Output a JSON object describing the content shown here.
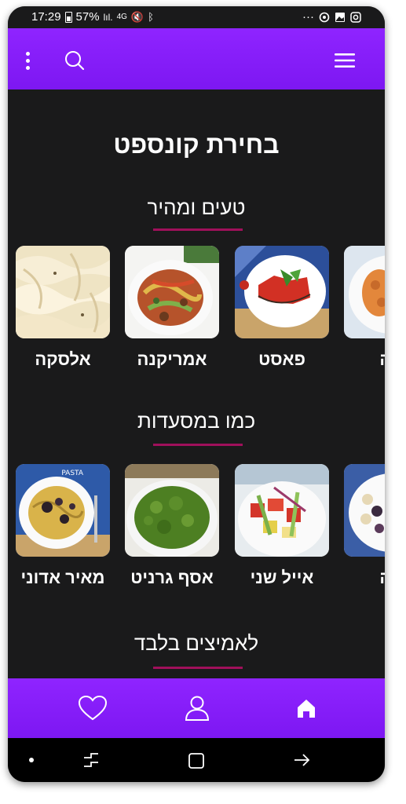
{
  "status_bar": {
    "time": "17:29",
    "battery": "57%",
    "signal": "4G",
    "more": "···"
  },
  "header": {
    "icons": [
      "menu-dots-icon",
      "search-icon",
      "hamburger-icon"
    ],
    "accent_color": "#8a21fb"
  },
  "page_title": "בחירת קונספט",
  "sections": [
    {
      "title": "טעים ומהיר",
      "cards": [
        "אלסקה",
        "אמריקנה",
        "פאסט",
        "פה"
      ]
    },
    {
      "title": "כמו במסעדות",
      "cards": [
        "מאיר אדוני",
        "אסף גרניט",
        "אייל שני",
        "פה"
      ]
    },
    {
      "title": "לאמיצים בלבד",
      "cards": []
    }
  ],
  "bottom_nav": {
    "items": [
      "heart-icon",
      "user-icon",
      "home-icon"
    ]
  },
  "system_nav": {
    "items": [
      "dot-icon",
      "recents-icon",
      "home-square-icon",
      "back-arrow-icon"
    ]
  }
}
